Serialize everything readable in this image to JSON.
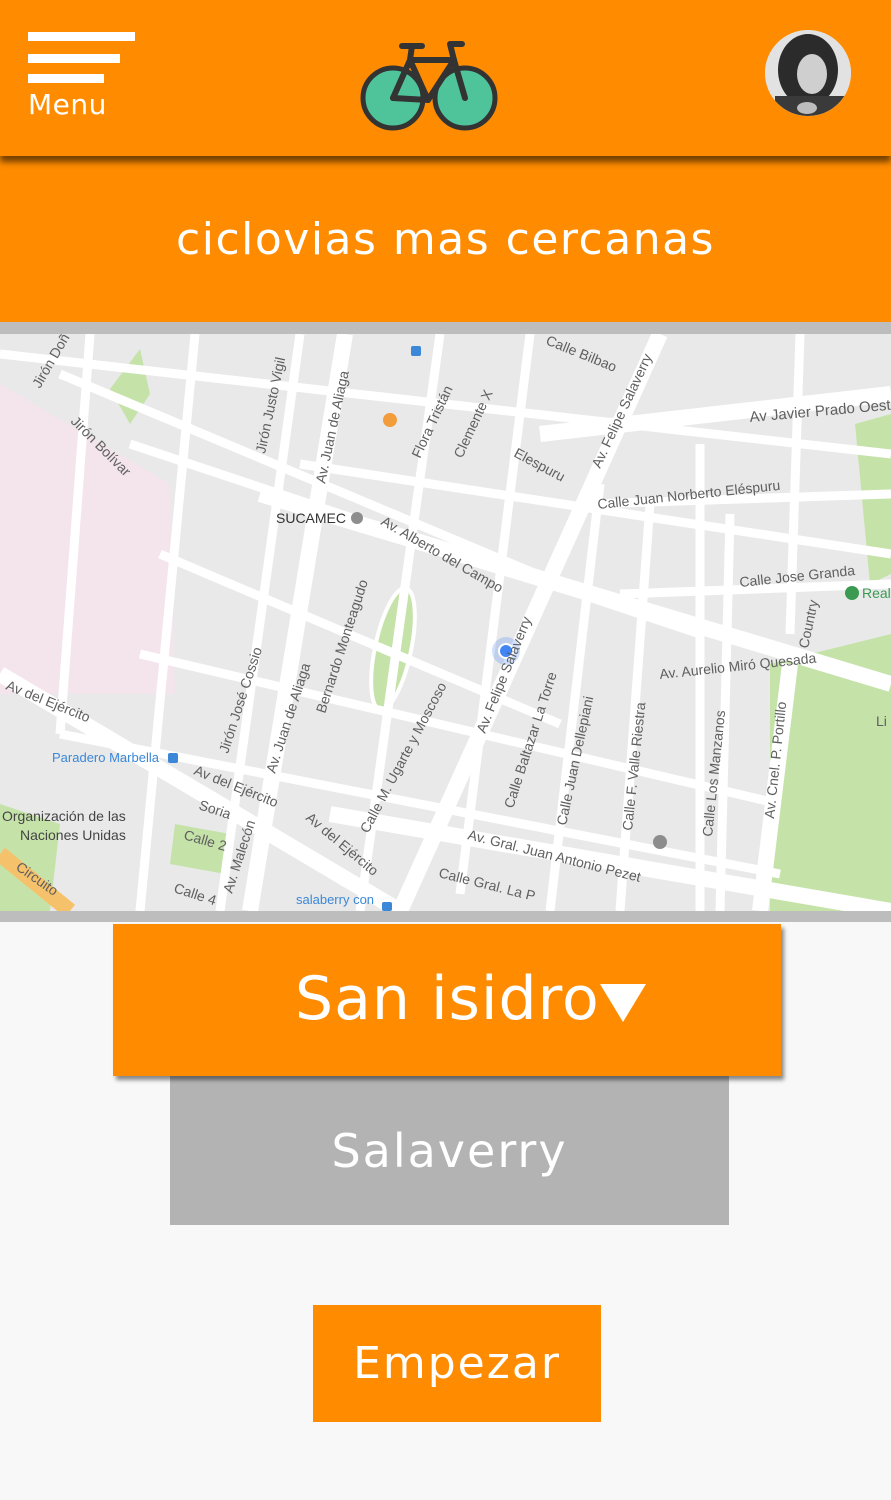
{
  "header": {
    "menu_label": "Menu",
    "logo_icon": "bicycle-icon",
    "avatar_icon": "user-avatar"
  },
  "title": "ciclovias mas cercanas",
  "map": {
    "streets": {
      "calle_bilbao": "Calle Bilbao",
      "av_felipe_salaverry_top": "Av. Felipe Salaverry",
      "av_javier_prado": "Av Javier Prado Oeste",
      "jiron_dona": "Jirón Doñ",
      "jiron_bolivar": "Jirón Bolívar",
      "jiron_justo_vigil": "Jirón Justo Vigil",
      "av_juan_de_aliaga_top": "Av. Juan de Aliaga",
      "flora_tristan": "Flora Tristán",
      "clemente_x": "Clemente X",
      "elespuru": "Elespuru",
      "calle_juan_norberto": "Calle Juan Norberto Eléspuru",
      "av_alberto_del_campo": "Av. Alberto del Campo",
      "calle_jose_granda": "Calle Jose Granda",
      "bernardo_monteagudo": "Bernardo Monteagudo",
      "jiron_jose_cossio": "Jirón José Cossio",
      "av_juan_de_aliaga_mid": "Av. Juan de Aliaga",
      "av_felipe_salaverry_mid": "Av. Felipe Salaverry",
      "calle_baltazar": "Calle Baltazar La Torre",
      "calle_juan_dellepiani": "Calle Juan Dellepiani",
      "calle_valle_riestra": "Calle F. Valle Riestra",
      "calle_los_manzanos": "Calle Los Manzanos",
      "av_cnel_portillo": "Av. Cnel. P. Portillo",
      "country": "Country",
      "av_aurelio_miro": "Av. Aurelio Miró Quesada",
      "calle_ugarte": "Calle M. Ugarte y Moscoso",
      "av_del_ejercito_left": "Av del Ejército",
      "av_del_ejercito_mid": "Av del Ejército",
      "av_del_ejercito_low": "Av del Ejército",
      "soria": "Soria",
      "calle_2": "Calle 2",
      "av_malecon": "Av. Malecón",
      "calle_4": "Calle 4",
      "circuito": "Circuito",
      "av_gral_pezet": "Av. Gral. Juan Antonio Pezet",
      "calle_gral_la": "Calle Gral. La P",
      "li": "Li"
    },
    "places": {
      "sucamec": "SUCAMEC",
      "paradero_marbella": "Paradero Marbella",
      "onu_line1": "Organización de las",
      "onu_line2": "Naciones Unidas",
      "salaberry": "salaberry con",
      "real": "Real"
    },
    "colors": {
      "road": "#ffffff",
      "block": "#e9e9e9",
      "park": "#c5e3a9",
      "pink_zone": "#f4e4ec",
      "location_dot": "#4285f4"
    }
  },
  "district_select": {
    "value": "San isidro",
    "caret_icon": "triangle-down-icon"
  },
  "option": "Salaverry",
  "start_button": "Empezar"
}
